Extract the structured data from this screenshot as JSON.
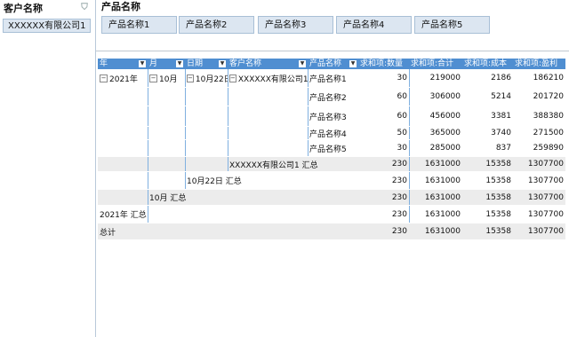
{
  "left_panel": {
    "title": "客户名称",
    "filter_icon": "filter-icon",
    "item": "XXXXXX有限公司1"
  },
  "right_panel": {
    "title": "产品名称",
    "chips": [
      "产品名称1",
      "产品名称2",
      "产品名称3",
      "产品名称4",
      "产品名称5"
    ]
  },
  "table": {
    "headers": [
      "年",
      "月",
      "日期",
      "客户名称",
      "产品名称",
      "求和项:数量",
      "求和项:合计",
      "求和项:成本",
      "求和项:盈利"
    ],
    "rows": [
      {
        "year": "2021年",
        "month": "10月",
        "date": "10月22日",
        "customer": "XXXXXX有限公司1",
        "product": "产品名称1",
        "qty": "30",
        "total": "219000",
        "cost": "2186",
        "profit": "186210"
      },
      {
        "year": "",
        "month": "",
        "date": "",
        "customer": "",
        "product": "产品名称2",
        "qty": "60",
        "total": "306000",
        "cost": "5214",
        "profit": "201720"
      },
      {
        "year": "",
        "month": "",
        "date": "",
        "customer": "",
        "product": "产品名称3",
        "qty": "60",
        "total": "456000",
        "cost": "3381",
        "profit": "388380"
      },
      {
        "year": "",
        "month": "",
        "date": "",
        "customer": "",
        "product": "产品名称4",
        "qty": "50",
        "total": "365000",
        "cost": "3740",
        "profit": "271500"
      },
      {
        "year": "",
        "month": "",
        "date": "",
        "customer": "",
        "product": "产品名称5",
        "qty": "30",
        "total": "285000",
        "cost": "837",
        "profit": "259890"
      }
    ],
    "subtotals": [
      {
        "label": "XXXXXX有限公司1 汇总",
        "qty": "230",
        "total": "1631000",
        "cost": "15358",
        "profit": "1307700"
      },
      {
        "label": "10月22日 汇总",
        "qty": "230",
        "total": "1631000",
        "cost": "15358",
        "profit": "1307700"
      },
      {
        "label": "10月 汇总",
        "qty": "230",
        "total": "1631000",
        "cost": "15358",
        "profit": "1307700"
      },
      {
        "label": "2021年 汇总",
        "qty": "230",
        "total": "1631000",
        "cost": "15358",
        "profit": "1307700"
      },
      {
        "label": "总计",
        "qty": "230",
        "total": "1631000",
        "cost": "15358",
        "profit": "1307700"
      }
    ]
  },
  "colors": {
    "header_bg": "#4f8ed1",
    "chip_bg": "#dce6f1",
    "alt_row": "#ececec"
  }
}
